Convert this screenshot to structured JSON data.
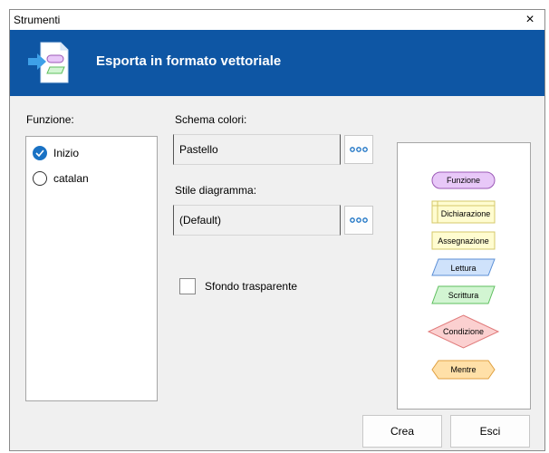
{
  "window": {
    "title": "Strumenti",
    "close_glyph": "×"
  },
  "banner": {
    "title": "Esporta in formato vettoriale",
    "icon": "export-document-icon"
  },
  "funzione": {
    "label": "Funzione:",
    "items": [
      {
        "label": "Inizio",
        "checked": true
      },
      {
        "label": "catalan",
        "checked": false
      }
    ]
  },
  "schema": {
    "label": "Schema colori:",
    "value": "Pastello"
  },
  "stile": {
    "label": "Stile diagramma:",
    "value": "(Default)"
  },
  "sfondo": {
    "label": "Sfondo trasparente",
    "checked": false
  },
  "preview": {
    "shapes": [
      {
        "label": "Funzione",
        "shape": "rounded",
        "fill": "#e8c8f8",
        "stroke": "#9b59b6"
      },
      {
        "label": "Dichiarazione",
        "shape": "declaration",
        "fill": "#fffcd0",
        "stroke": "#d4c86a"
      },
      {
        "label": "Assegnazione",
        "shape": "rect",
        "fill": "#fffcd0",
        "stroke": "#d4c86a"
      },
      {
        "label": "Lettura",
        "shape": "parallelogram",
        "fill": "#cfe2fb",
        "stroke": "#5b8fd6"
      },
      {
        "label": "Scrittura",
        "shape": "parallelogram",
        "fill": "#d2f5d2",
        "stroke": "#5fbf5f"
      },
      {
        "label": "Condizione",
        "shape": "diamond",
        "fill": "#fbd0d0",
        "stroke": "#e07a7a"
      },
      {
        "label": "Mentre",
        "shape": "hexagon",
        "fill": "#ffe0a8",
        "stroke": "#e0a040"
      }
    ]
  },
  "buttons": {
    "crea": "Crea",
    "esci": "Esci"
  },
  "colors": {
    "banner": "#0e56a4",
    "radio_checked": "#1a72c4"
  }
}
